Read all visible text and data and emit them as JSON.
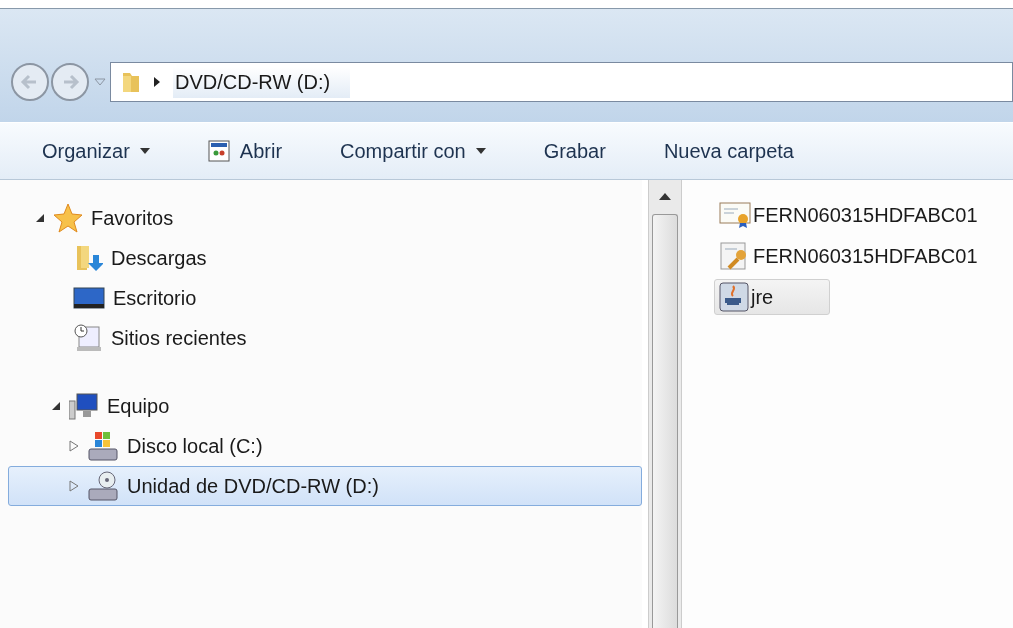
{
  "address_bar": {
    "path": "DVD/CD-RW (D:)"
  },
  "toolbar": [
    {
      "label": "Organizar",
      "has_menu": true
    },
    {
      "label": "Abrir",
      "has_menu": false
    },
    {
      "label": "Compartir con",
      "has_menu": true
    },
    {
      "label": "Grabar",
      "has_menu": false
    },
    {
      "label": "Nueva carpeta",
      "has_menu": false
    }
  ],
  "nav_tree": [
    {
      "label": "Favoritos",
      "expanded": true,
      "selected": false,
      "children": [
        {
          "label": "Descargas",
          "selected": false
        },
        {
          "label": "Escritorio",
          "selected": false
        },
        {
          "label": "Sitios recientes",
          "selected": false
        }
      ]
    },
    {
      "label": "Equipo",
      "expanded": true,
      "selected": false,
      "children": [
        {
          "label": "Disco local (C:)",
          "expanded": false,
          "selected": false
        },
        {
          "label": "Unidad de DVD/CD-RW (D:)",
          "expanded": false,
          "selected": true
        }
      ]
    }
  ],
  "files": [
    {
      "name": "FERN060315HDFABC01",
      "selected": false
    },
    {
      "name": "FERN060315HDFABC01",
      "selected": false
    },
    {
      "name": "jre",
      "selected": true
    }
  ]
}
